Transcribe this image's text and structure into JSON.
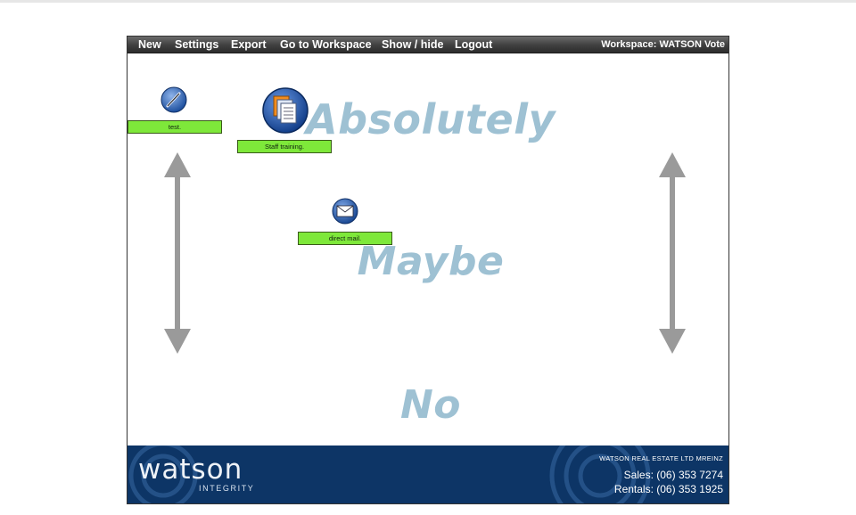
{
  "menu": {
    "items": [
      "New",
      "Settings",
      "Export",
      "Go to Workspace",
      "Show / hide",
      "Logout"
    ],
    "workspace": "Workspace: WATSON Vote"
  },
  "zones": {
    "top": "Absolutely",
    "middle": "Maybe",
    "bottom": "No"
  },
  "nodes": [
    {
      "label": "test.",
      "icon": "pen-icon"
    },
    {
      "label": "Staff training.",
      "icon": "documents-icon"
    },
    {
      "label": "direct mail.",
      "icon": "envelope-icon"
    }
  ],
  "footer": {
    "brand": "watson",
    "brand_sub": "INTEGRITY",
    "company": "WATSON REAL ESTATE LTD MREINZ",
    "sales": "Sales: (06) 353 7274",
    "rentals": "Rentals: (06) 353 1925"
  },
  "colors": {
    "menubar": "#3f3f3f",
    "zone_text": "#9ec1d3",
    "node_label_bg": "#7ee83a",
    "footer_bg": "#0d3566",
    "arrow": "#9a9a9a"
  }
}
